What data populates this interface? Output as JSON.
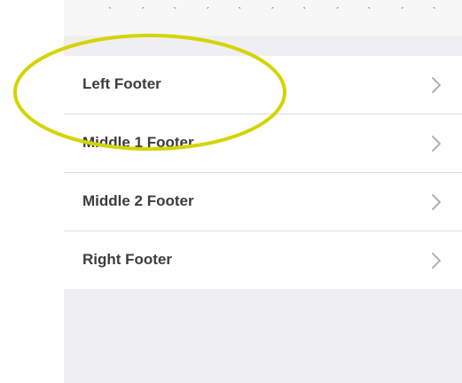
{
  "footer_settings": {
    "items": [
      {
        "label": "Left Footer",
        "icon": "chevron-right-icon"
      },
      {
        "label": "Middle 1 Footer",
        "icon": "chevron-right-icon"
      },
      {
        "label": "Middle 2 Footer",
        "icon": "chevron-right-icon"
      },
      {
        "label": "Right Footer",
        "icon": "chevron-right-icon"
      }
    ]
  },
  "colors": {
    "panel_background": "#efeff1",
    "row_background": "#ffffff",
    "divider": "#dcdce0",
    "text": "#3c3c3e",
    "chevron": "#b0b0b5",
    "annotation_ellipse": "#d4d400"
  }
}
